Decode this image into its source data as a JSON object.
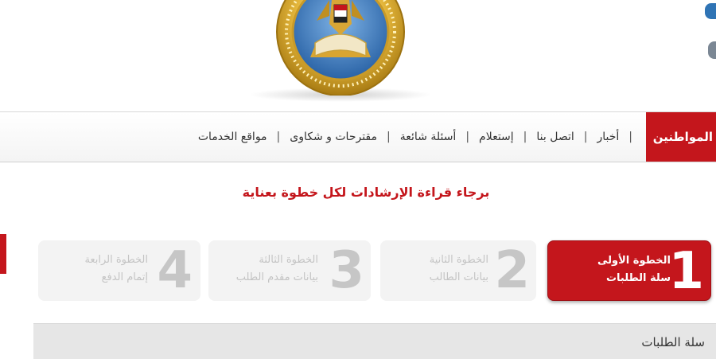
{
  "nav": {
    "active_label": "المواطنين",
    "items": [
      "مواقع الخدمات",
      "مقترحات و شكاوى",
      "أسئلة شائعة",
      "إستعلام",
      "اتصل بنا",
      "أخبار"
    ],
    "separator": "|"
  },
  "instruction": "برجاء قراءة الإرشادات لكل خطوة بعناية",
  "steps": [
    {
      "number": "1",
      "line1": "الخطوة الأولى",
      "line2": "سلة الطلبات",
      "state": "active"
    },
    {
      "number": "2",
      "line1": "الخطوة الثانية",
      "line2": "بيانات الطالب",
      "state": "inactive"
    },
    {
      "number": "3",
      "line1": "الخطوة الثالثة",
      "line2": "بيانات مقدم الطلب",
      "state": "inactive"
    },
    {
      "number": "4",
      "line1": "الخطوة الرابعة",
      "line2": "إتمام الدفع",
      "state": "inactive"
    }
  ],
  "panel": {
    "title": "سلة الطلبات"
  },
  "colors": {
    "accent": "#c4161c",
    "logo_gold": "#d4a62a",
    "logo_blue": "#2f74b5"
  }
}
